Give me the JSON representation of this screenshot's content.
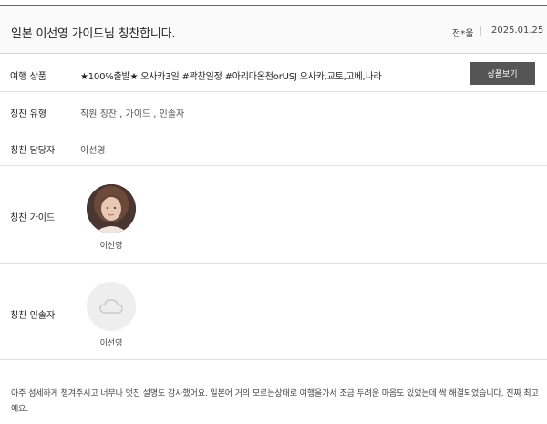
{
  "header": {
    "title": "일본 이선영 가이드님 칭찬합니다.",
    "author": "전*울",
    "date": "2025.01.25"
  },
  "rows": {
    "product": {
      "label": "여행 상품",
      "value": "★100%출발★ 오사카3일 #꽉찬일정 #아리마온천orUSJ 오사카,교토,고베,나라",
      "button": "상품보기"
    },
    "type": {
      "label": "칭찬 유형",
      "value": "직원 칭찬 , 가이드 , 인솔자"
    },
    "manager": {
      "label": "칭찬 담당자",
      "value": "이선영"
    },
    "guide": {
      "label": "칭찬 가이드",
      "name": "이선영",
      "avatar": "guide-photo"
    },
    "leader": {
      "label": "칭찬 인솔자",
      "name": "이선영",
      "avatar": "cloud-placeholder-icon"
    }
  },
  "comment": "아주 섬세하게 챙겨주시고 너무나 멋진 설명도 감사했어요. 일본어 거의 모르는상태로 여행을가서 조금 두려운 마음도 있었는데 싹 해결되었습니다. 진짜 최고 예요."
}
